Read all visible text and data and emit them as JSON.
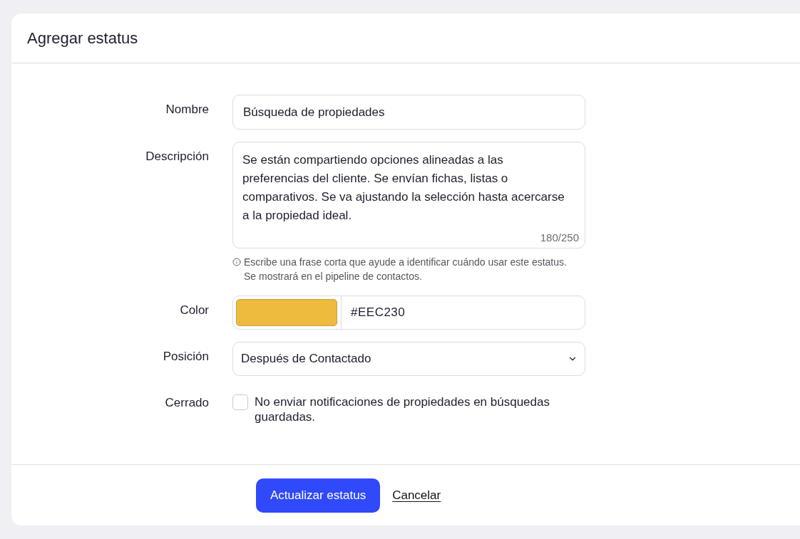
{
  "dialog": {
    "title": "Agregar estatus"
  },
  "form": {
    "fields": [
      {
        "kind": "text",
        "label": "Nombre",
        "value": "Búsqueda de propiedades"
      },
      {
        "kind": "textarea",
        "label": "Descripción",
        "value": "Se están compartiendo opciones alineadas a las preferencias del cliente. Se envían fichas, listas o comparativos. Se va ajustando la selección hasta acercarse a la propiedad ideal.",
        "counter": "180/250",
        "help": [
          "Escribe una frase corta que ayude a identificar cuándo usar este estatus.",
          "Se mostrará en el pipeline de contactos."
        ]
      },
      {
        "kind": "color",
        "label": "Color",
        "value": "#EEC230",
        "color": "#eebb3e"
      },
      {
        "kind": "select",
        "label": "Posición",
        "value": "Después de Contactado"
      },
      {
        "kind": "checkbox",
        "label": "Cerrado",
        "text": "No enviar notificaciones de propiedades en búsquedas guardadas.",
        "checked": false
      }
    ]
  },
  "footer": {
    "buttons": [
      {
        "kind": "primary",
        "label": "Actualizar estatus"
      },
      {
        "kind": "link",
        "label": "Cancelar"
      }
    ]
  }
}
